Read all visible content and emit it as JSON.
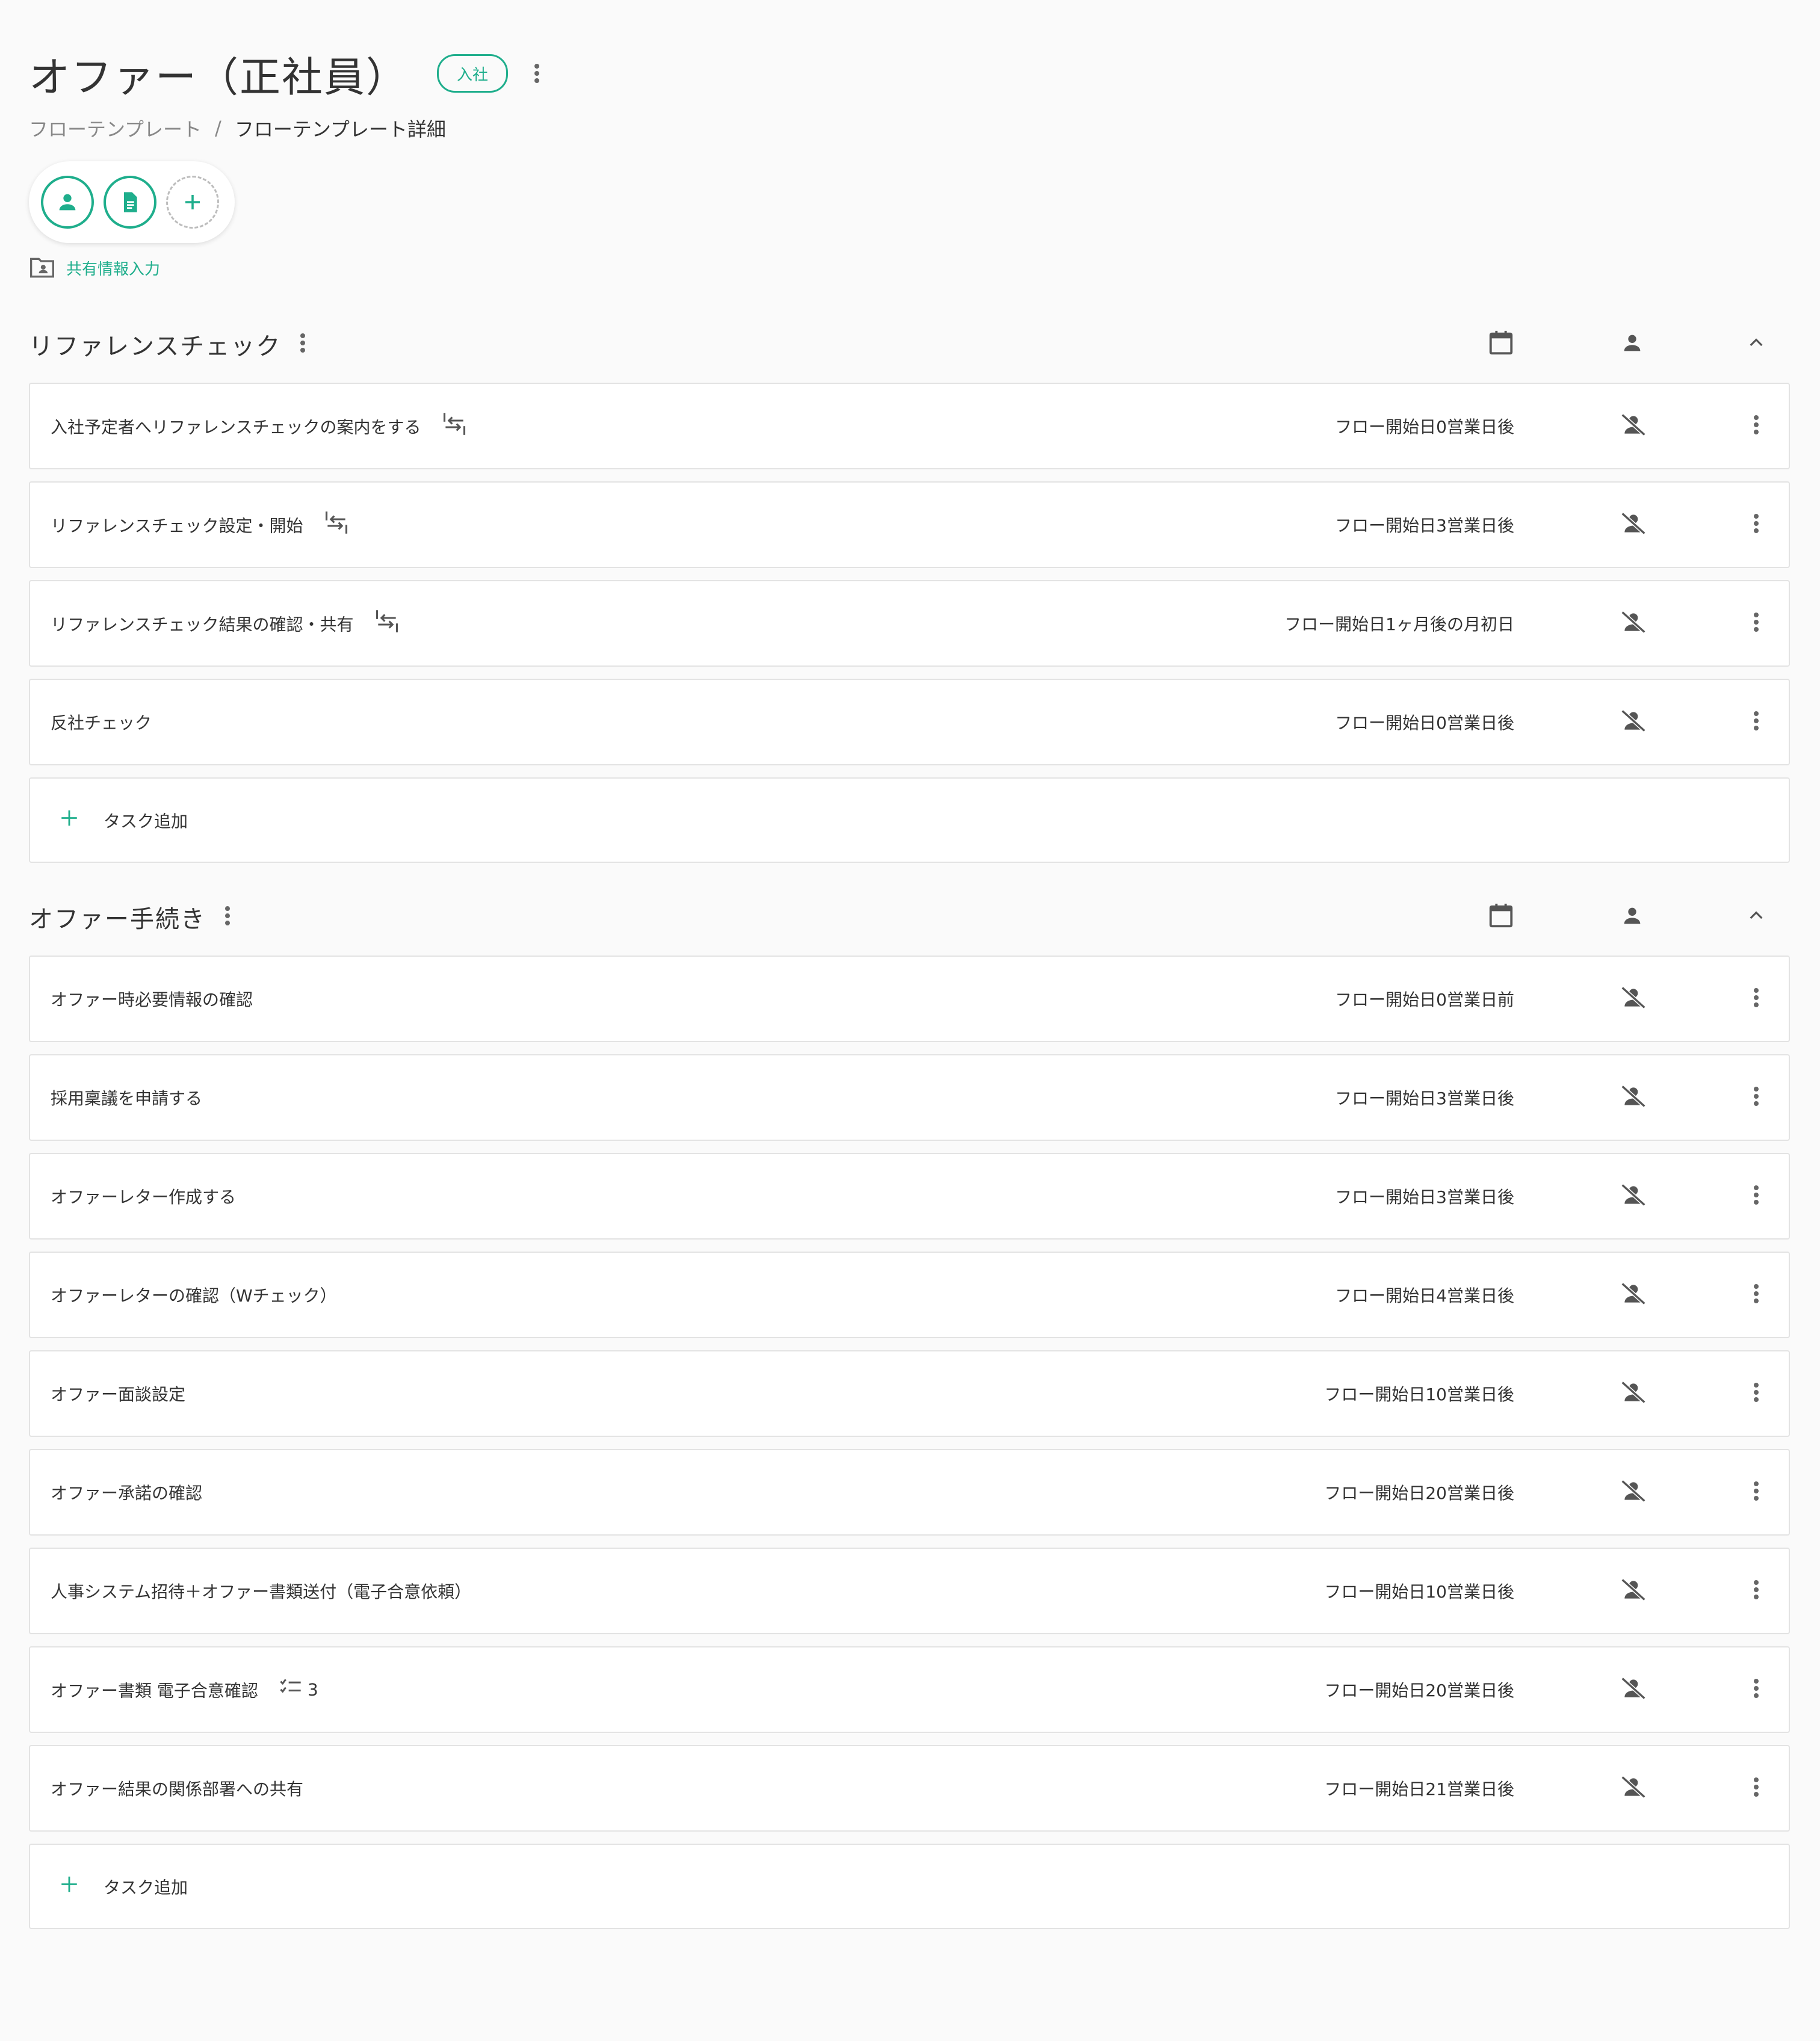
{
  "header": {
    "title": "オファー（正社員）",
    "badge": "入社"
  },
  "breadcrumb": {
    "parent": "フローテンプレート",
    "separator": "/",
    "current": "フローテンプレート詳細"
  },
  "toolbar_icons": [
    "person-icon",
    "document-icon",
    "add-icon"
  ],
  "shared_info": {
    "label": "共有情報入力",
    "icon": "folder-person-icon"
  },
  "colors": {
    "accent": "#1fae8c",
    "text": "#333333",
    "border": "#e3e3e3",
    "background": "#fafafa"
  },
  "sections": [
    {
      "title": "リファレンスチェック",
      "tasks": [
        {
          "name": "入社予定者へリファレンスチェックの案内をする",
          "due": "フロー開始日0営業日後",
          "sync_icon": true
        },
        {
          "name": "リファレンスチェック設定・開始",
          "due": "フロー開始日3営業日後",
          "sync_icon": true
        },
        {
          "name": "リファレンスチェック結果の確認・共有",
          "due": "フロー開始日1ヶ月後の月初日",
          "sync_icon": true
        },
        {
          "name": "反社チェック",
          "due": "フロー開始日0営業日後"
        }
      ],
      "add_label": "タスク追加"
    },
    {
      "title": "オファー手続き",
      "tasks": [
        {
          "name": "オファー時必要情報の確認",
          "due": "フロー開始日0営業日前"
        },
        {
          "name": "採用稟議を申請する",
          "due": "フロー開始日3営業日後"
        },
        {
          "name": "オファーレター作成する",
          "due": "フロー開始日3営業日後"
        },
        {
          "name": "オファーレターの確認（Wチェック）",
          "due": "フロー開始日4営業日後"
        },
        {
          "name": "オファー面談設定",
          "due": "フロー開始日10営業日後"
        },
        {
          "name": "オファー承諾の確認",
          "due": "フロー開始日20営業日後"
        },
        {
          "name": "人事システム招待＋オファー書類送付（電子合意依頼）",
          "due": "フロー開始日10営業日後"
        },
        {
          "name": "オファー書類 電子合意確認",
          "due": "フロー開始日20営業日後",
          "checklist_count": "3"
        },
        {
          "name": "オファー結果の関係部署への共有",
          "due": "フロー開始日21営業日後"
        }
      ],
      "add_label": "タスク追加"
    }
  ]
}
